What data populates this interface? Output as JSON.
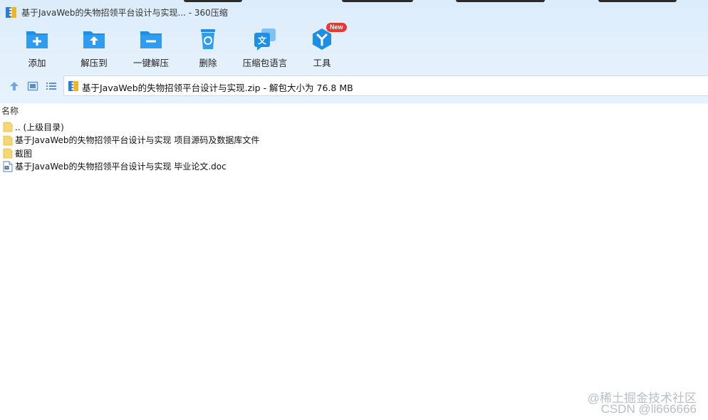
{
  "window": {
    "title": "基于JavaWeb的失物招领平台设计与实现... - 360压缩",
    "app_icon": "archive-icon"
  },
  "toolbar": {
    "buttons": [
      {
        "label": "添加",
        "icon": "add-folder-icon"
      },
      {
        "label": "解压到",
        "icon": "extract-to-icon"
      },
      {
        "label": "一键解压",
        "icon": "one-click-extract-icon"
      },
      {
        "label": "删除",
        "icon": "recycle-bin-icon"
      },
      {
        "label": "压缩包语言",
        "icon": "language-icon"
      },
      {
        "label": "工具",
        "icon": "tools-icon",
        "badge": "New"
      }
    ],
    "accent_color": "#1e8fe6"
  },
  "address": {
    "path": "基于JavaWeb的失物招领平台设计与实现.zip - 解包大小为 76.8 MB",
    "nav": [
      "up-arrow-icon",
      "thumbnail-view-icon",
      "list-view-icon"
    ]
  },
  "filelist": {
    "column_header": "名称",
    "items": [
      {
        "name": ".. (上级目录)",
        "type": "folder"
      },
      {
        "name": "基于JavaWeb的失物招领平台设计与实现 项目源码及数据库文件",
        "type": "folder-file"
      },
      {
        "name": "截图",
        "type": "folder"
      },
      {
        "name": "基于JavaWeb的失物招领平台设计与实现 毕业论文.doc",
        "type": "doc"
      }
    ]
  },
  "watermark": {
    "line1": "@稀土掘金技术社区",
    "line2": "CSDN @ll666666"
  }
}
